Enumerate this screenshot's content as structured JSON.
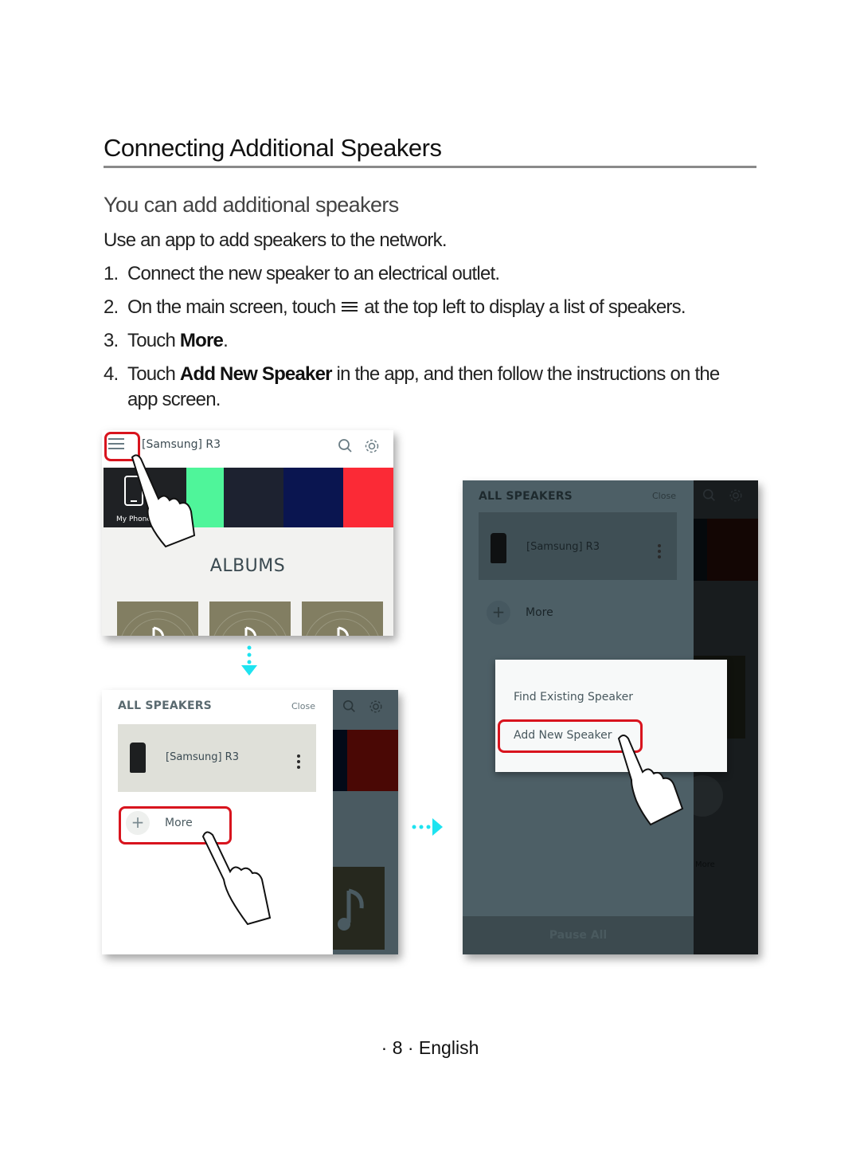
{
  "document": {
    "title": "Connecting Additional Speakers",
    "subtitle": "You can add additional speakers",
    "intro": "Use an app to add speakers to the network.",
    "steps": [
      {
        "num": "1.",
        "text": "Connect the new speaker to an electrical outlet."
      },
      {
        "num": "2.",
        "pre": "On the main screen, touch",
        "icon": "hamburger-menu-icon",
        "post": "at the top left to display a list of speakers."
      },
      {
        "num": "3.",
        "pre": "Touch",
        "bold": "More",
        "post": "."
      },
      {
        "num": "4.",
        "pre": "Touch",
        "bold": "Add New Speaker",
        "post": "in the app, and then follow the instructions on the",
        "continuation": "app screen."
      }
    ],
    "footer": "· 8 · English"
  },
  "screen1": {
    "app_title": "[Samsung] R3",
    "tile_label": "My Phone",
    "section_label": "ALBUMS",
    "tile_colors": [
      "#1f2124",
      "#4ff59a",
      "#1d2230",
      "#0a1550",
      "#fb2a36"
    ],
    "album_color": "#827e62"
  },
  "screen2": {
    "drawer_title": "ALL SPEAKERS",
    "close_label": "Close",
    "speaker_name": "[Samsung] R3",
    "more_label": "More",
    "plus": "+"
  },
  "screen3": {
    "drawer_title": "ALL SPEAKERS",
    "close_label": "Close",
    "speaker_name": "[Samsung] R3",
    "more_label": "More",
    "plus": "+",
    "popup_items": [
      "Find Existing Speaker",
      "Add New Speaker"
    ],
    "pause_label": "Pause All",
    "bg_more_label": "More"
  },
  "colors": {
    "highlight": "#d8141e",
    "arrow": "#1ee3f0"
  }
}
